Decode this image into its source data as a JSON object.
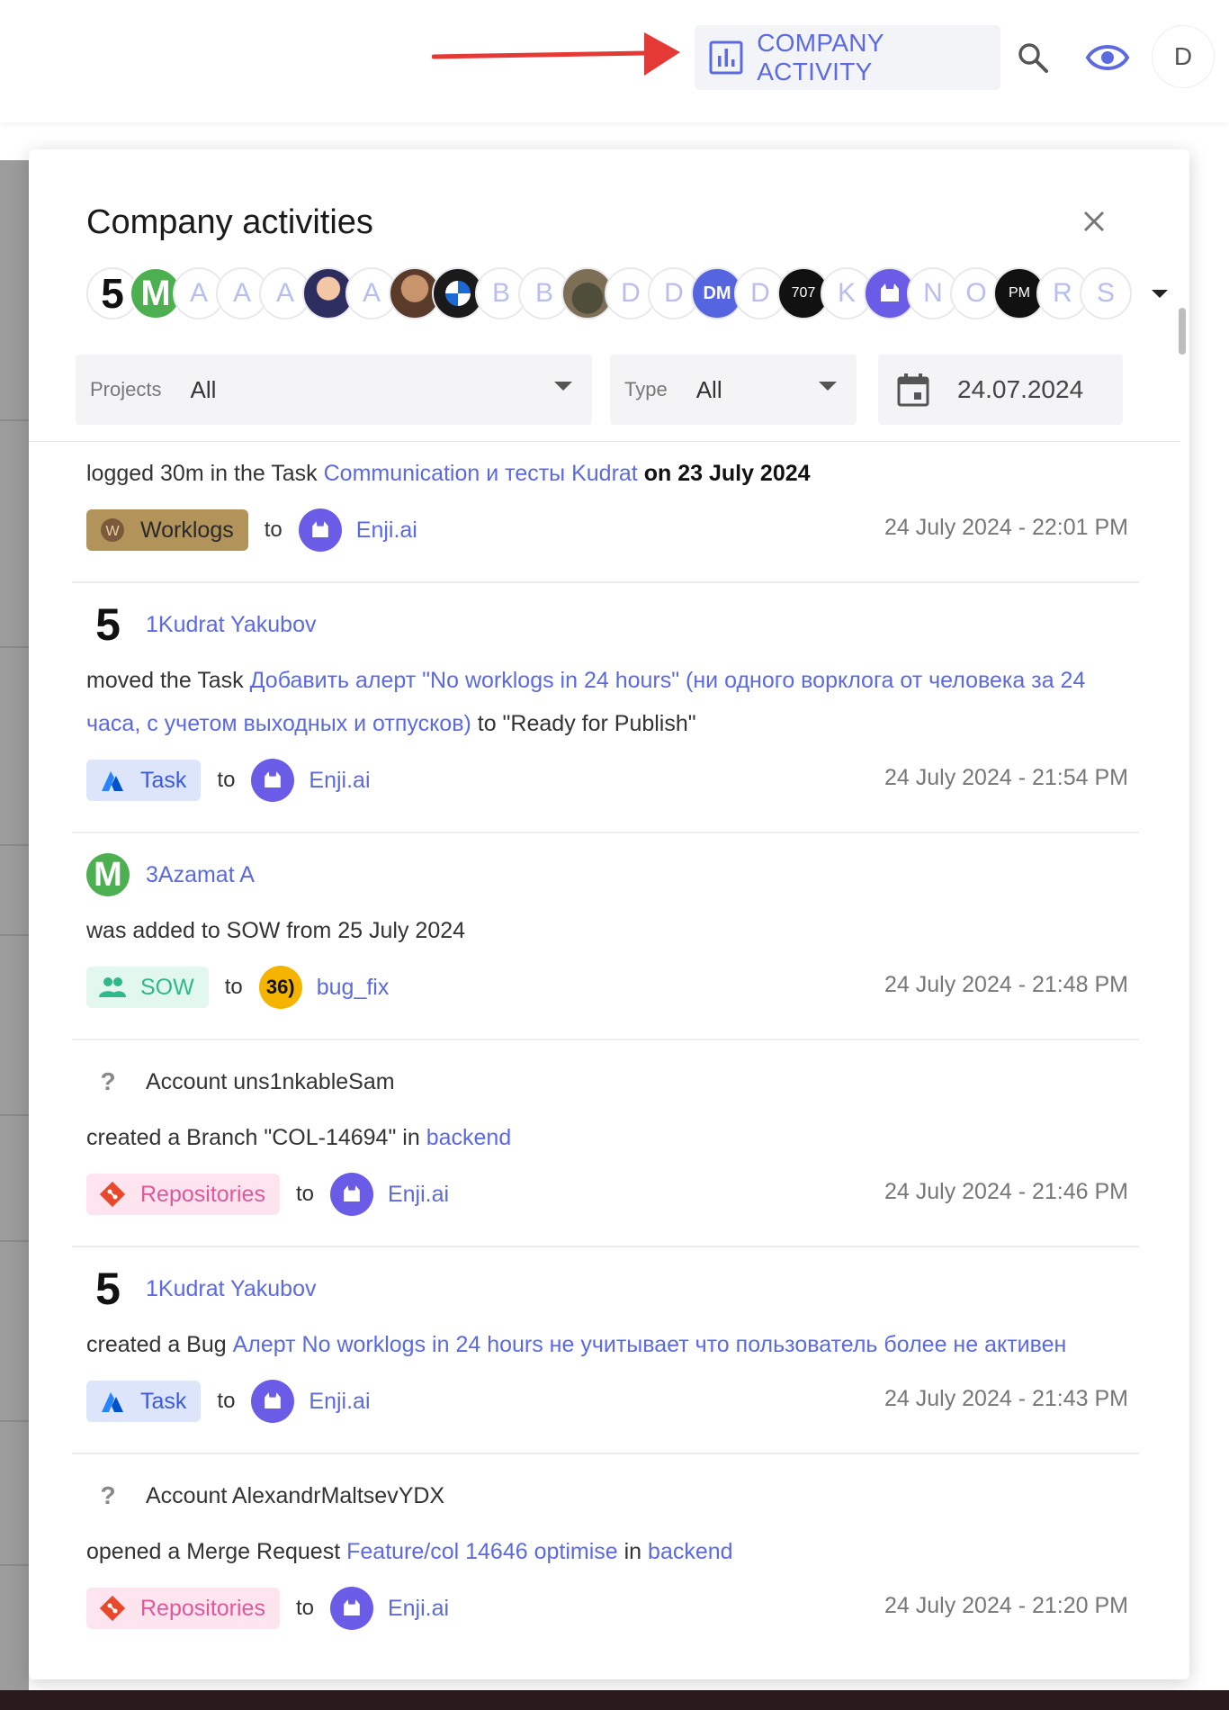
{
  "topbar": {
    "company_activity_label": "COMPANY ACTIVITY",
    "avatar_letter": "D"
  },
  "panel": {
    "title": "Company activities",
    "avatars": [
      "5",
      "M",
      "A",
      "A",
      "A",
      "",
      "A",
      "",
      "",
      "B",
      "B",
      "",
      "D",
      "D",
      "DM",
      "D",
      "707",
      "K",
      "Enji.ai",
      "N",
      "O",
      "PM",
      "R",
      "S"
    ],
    "filters": {
      "projects_label": "Projects",
      "projects_value": "All",
      "type_label": "Type",
      "type_value": "All",
      "date_value": "24.07.2024"
    }
  },
  "feed": [
    {
      "user": "",
      "action": "logged 30m in the Task",
      "link": "Communication и тесты Kudrat",
      "suffix": "on 23 July 2024",
      "tag": "Worklogs",
      "to": "to",
      "project": "Enji.ai",
      "time": "24 July 2024 - 22:01 PM"
    },
    {
      "user": "1Kudrat Yakubov",
      "action": "moved the Task",
      "link": "Добавить алерт \"No worklogs in 24 hours\" (ни одного ворклога от человека за 24 часа, с учетом выходных и отпусков)",
      "suffix": "to \"Ready for Publish\"",
      "tag": "Task",
      "to": "to",
      "project": "Enji.ai",
      "time": "24 July 2024 - 21:54 PM"
    },
    {
      "user": "3Azamat A",
      "action": "was added to SOW from 25 July 2024",
      "tag": "SOW",
      "to": "to",
      "project": "bug_fix",
      "project_icon_text": "36)",
      "time": "24 July 2024 - 21:48 PM"
    },
    {
      "user": "Account uns1nkableSam",
      "action": "created a Branch \"COL-14694\" in",
      "link": "backend",
      "tag": "Repositories",
      "to": "to",
      "project": "Enji.ai",
      "time": "24 July 2024 - 21:46 PM"
    },
    {
      "user": "1Kudrat Yakubov",
      "action": "created a Bug",
      "link": "Алерт No worklogs in 24 hours не учитывает что пользователь более не активен",
      "tag": "Task",
      "to": "to",
      "project": "Enji.ai",
      "time": "24 July 2024 - 21:43 PM"
    },
    {
      "user": "Account AlexandrMaltsevYDX",
      "action": "opened a Merge Request",
      "link": "Feature/col 14646 optimise",
      "mid": "in",
      "link2": "backend",
      "tag": "Repositories",
      "to": "to",
      "project": "Enji.ai",
      "time": "24 July 2024 - 21:20 PM"
    }
  ],
  "colors": {
    "accent": "#5b6ae0",
    "worklogs_tag": "#b2935a",
    "task_tag": "#dde5fb",
    "sow_tag": "#e2f7ee",
    "repo_tag": "#fde4ee",
    "arrow": "#e53935"
  }
}
